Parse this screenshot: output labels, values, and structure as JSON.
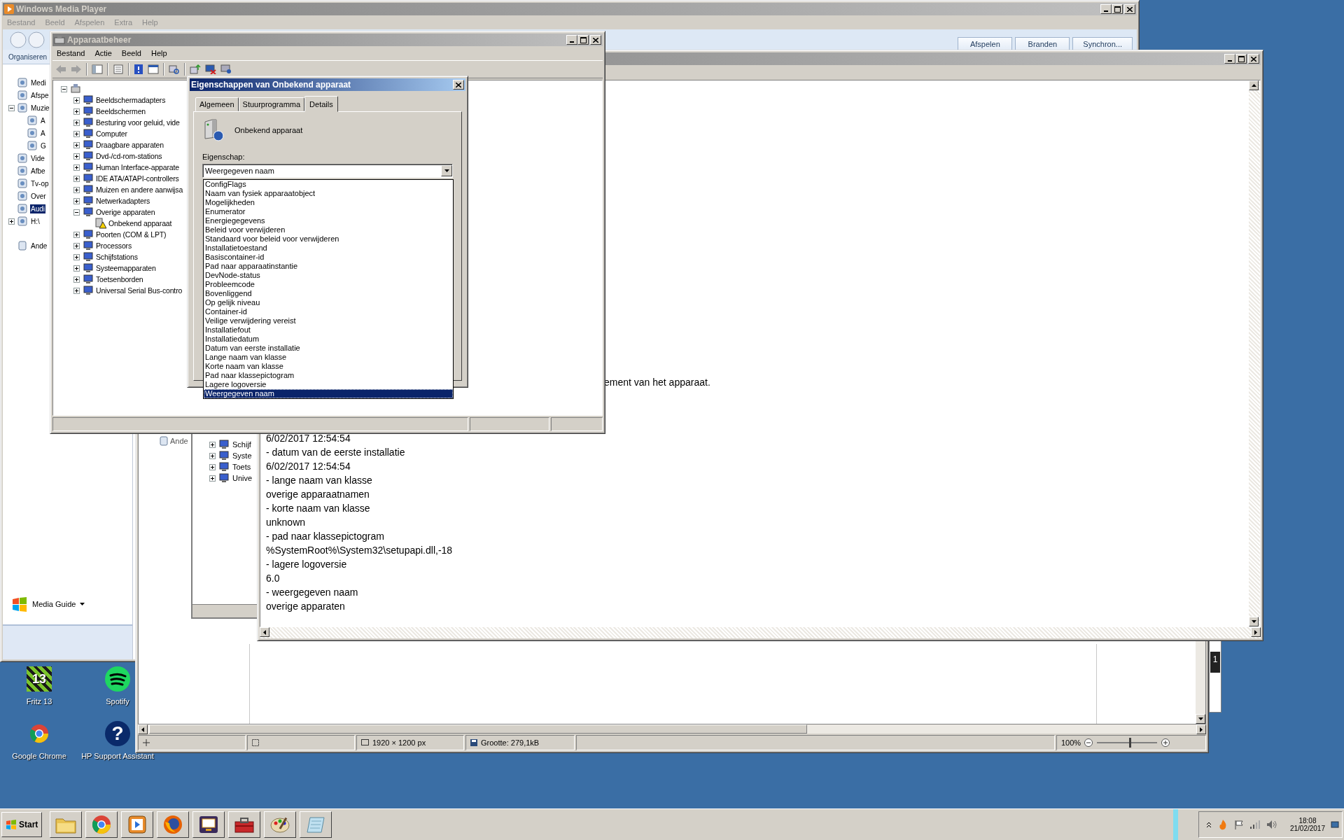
{
  "media_player": {
    "title": "Windows Media Player",
    "active": false,
    "menu": [
      "Bestand",
      "Beeld",
      "Afspelen",
      "Extra",
      "Help"
    ],
    "tabs": [
      {
        "label": "Afspelen",
        "selected": false
      },
      {
        "label": "Branden",
        "selected": false
      },
      {
        "label": "Synchron...",
        "selected": false
      }
    ],
    "organize": "Organiseren",
    "nav": [
      {
        "label": "Medi",
        "selected": false
      },
      {
        "label": "Afspe",
        "selected": false
      },
      {
        "label": "Muzie",
        "selected": false,
        "expanded": true,
        "children": [
          {
            "label": "A",
            "selected": false
          },
          {
            "label": "A",
            "selected": false
          },
          {
            "label": "G",
            "selected": false
          }
        ]
      },
      {
        "label": "Vide",
        "selected": false
      },
      {
        "label": "Afbe",
        "selected": false
      },
      {
        "label": "Tv-op",
        "selected": false
      },
      {
        "label": "Over",
        "selected": false
      },
      {
        "label": "Audi",
        "selected": true
      },
      {
        "label": "H:\\",
        "selected": false,
        "expanded": false
      }
    ],
    "other_libraries": "Ande",
    "media_guide": "Media Guide"
  },
  "image_viewer": {
    "shot_label": "Ande",
    "shot_tree": [
      "Schijf",
      "Syste",
      "Toets",
      "Unive"
    ],
    "dimensions": "1920 × 1200 px",
    "file_size": "Grootte: 279,1kB",
    "zoom": "100%",
    "zoom_slider": {
      "level": 0.55
    }
  },
  "side_window": {
    "badge": "1"
  },
  "text_window": {
    "active": false,
    "partial_line": "ement van het apparaat.",
    "lines": [
      "6/02/2017 12:54:54",
      "- datum van de eerste installatie",
      "6/02/2017 12:54:54",
      "- lange naam van klasse",
      "overige apparaatnamen",
      "- korte naam van klasse",
      "unknown",
      "- pad naar klassepictogram",
      "%SystemRoot%\\System32\\setupapi.dll,-18",
      "- lagere logoversie",
      "6.0",
      "- weergegeven naam",
      "overige apparaten"
    ]
  },
  "device_manager": {
    "title": "Apparaatbeheer",
    "active": false,
    "menu": [
      "Bestand",
      "Actie",
      "Beeld",
      "Help"
    ],
    "tree": {
      "expanded": true,
      "children": [
        {
          "label": "Beeldschermadapters",
          "expanded": false
        },
        {
          "label": "Beeldschermen",
          "expanded": false
        },
        {
          "label": "Besturing voor geluid, vide",
          "expanded": false
        },
        {
          "label": "Computer",
          "expanded": false
        },
        {
          "label": "Draagbare apparaten",
          "expanded": false
        },
        {
          "label": "Dvd-/cd-rom-stations",
          "expanded": false
        },
        {
          "label": "Human Interface-apparate",
          "expanded": false
        },
        {
          "label": "IDE ATA/ATAPI-controllers",
          "expanded": false
        },
        {
          "label": "Muizen en andere aanwijsa",
          "expanded": false
        },
        {
          "label": "Netwerkadapters",
          "expanded": false
        },
        {
          "label": "Overige apparaten",
          "expanded": true,
          "children": [
            {
              "label": "Onbekend apparaat",
              "warning": true
            }
          ]
        },
        {
          "label": "Poorten (COM & LPT)",
          "expanded": false
        },
        {
          "label": "Processors",
          "expanded": false
        },
        {
          "label": "Schijfstations",
          "expanded": false
        },
        {
          "label": "Systeemapparaten",
          "expanded": false
        },
        {
          "label": "Toetsenborden",
          "expanded": false
        },
        {
          "label": "Universal Serial Bus-contro",
          "expanded": false
        }
      ]
    }
  },
  "dialog": {
    "title": "Eigenschappen van Onbekend apparaat",
    "active": true,
    "tabs": [
      {
        "label": "Algemeen",
        "selected": false
      },
      {
        "label": "Stuurprogramma",
        "selected": false
      },
      {
        "label": "Details",
        "selected": true
      }
    ],
    "device_name": "Onbekend apparaat",
    "property_label": "Eigenschap:",
    "property_value": "Weergegeven naam",
    "options": [
      {
        "label": "ConfigFlags",
        "selected": false
      },
      {
        "label": "Naam van fysiek apparaatobject",
        "selected": false
      },
      {
        "label": "Mogelijkheden",
        "selected": false
      },
      {
        "label": "Enumerator",
        "selected": false
      },
      {
        "label": "Energiegegevens",
        "selected": false
      },
      {
        "label": "Beleid voor verwijderen",
        "selected": false
      },
      {
        "label": "Standaard voor beleid voor verwijderen",
        "selected": false
      },
      {
        "label": "Installatietoestand",
        "selected": false
      },
      {
        "label": "Basiscontainer-id",
        "selected": false
      },
      {
        "label": "Pad naar apparaatinstantie",
        "selected": false
      },
      {
        "label": "DevNode-status",
        "selected": false
      },
      {
        "label": "Probleemcode",
        "selected": false
      },
      {
        "label": "Bovenliggend",
        "selected": false
      },
      {
        "label": "Op gelijk niveau",
        "selected": false
      },
      {
        "label": "Container-id",
        "selected": false
      },
      {
        "label": "Veilige verwijdering vereist",
        "selected": false
      },
      {
        "label": "Installatiefout",
        "selected": false
      },
      {
        "label": "Installatiedatum",
        "selected": false
      },
      {
        "label": "Datum van eerste installatie",
        "selected": false
      },
      {
        "label": "Lange naam van klasse",
        "selected": false
      },
      {
        "label": "Korte naam van klasse",
        "selected": false
      },
      {
        "label": "Pad naar klassepictogram",
        "selected": false
      },
      {
        "label": "Lagere logoversie",
        "selected": false
      },
      {
        "label": "Weergegeven naam",
        "selected": true
      }
    ]
  },
  "desktop_icons": [
    {
      "label": "Fritz 13",
      "kind": "fritz",
      "badge": "13"
    },
    {
      "label": "Spotify",
      "kind": "spotify"
    },
    {
      "label": "Google Chrome",
      "kind": "chrome"
    },
    {
      "label": "HP Support Assistant",
      "kind": "help",
      "badge": "?"
    }
  ],
  "taskbar": {
    "start": "Start",
    "apps": [
      {
        "kind": "folder"
      },
      {
        "kind": "chrome"
      },
      {
        "kind": "player"
      },
      {
        "kind": "firefox"
      },
      {
        "kind": "monitor"
      },
      {
        "kind": "toolbox"
      },
      {
        "kind": "paint"
      },
      {
        "kind": "notepad"
      }
    ],
    "time": "18:08",
    "date": "21/02/2017"
  }
}
